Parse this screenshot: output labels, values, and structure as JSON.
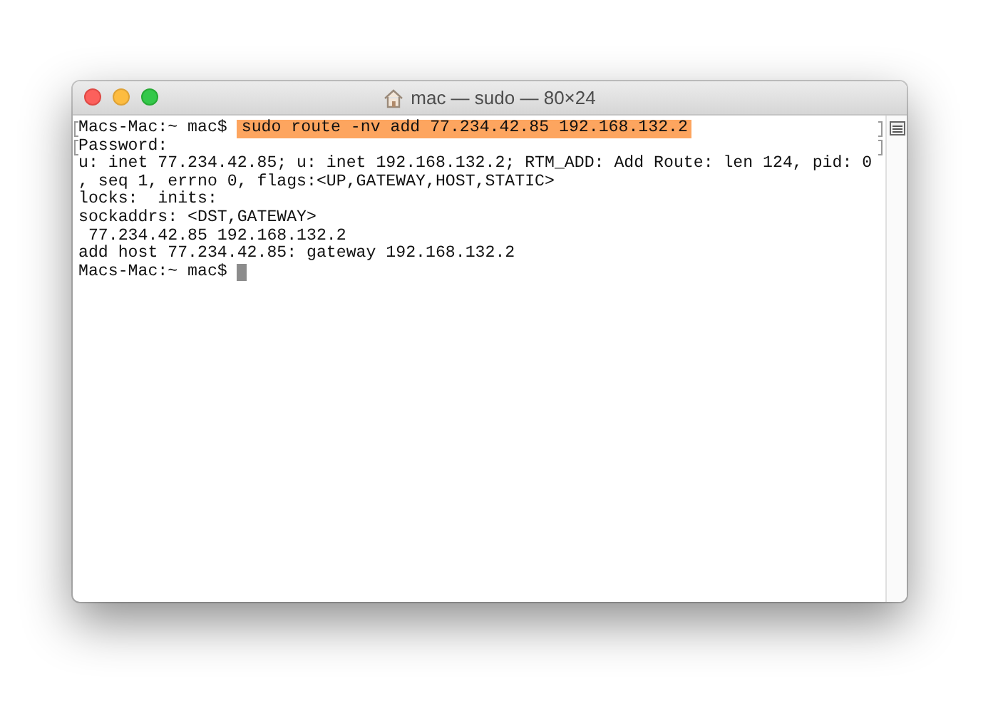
{
  "window": {
    "title": "mac — sudo — 80×24"
  },
  "lines": [
    {
      "kind": "prompt",
      "prompt": "Macs-Mac:~ mac$",
      "command": "sudo route -nv add 77.234.42.85 192.168.132.2",
      "highlighted": true,
      "marked": true,
      "cursor": false
    },
    {
      "kind": "output",
      "text": "Password:",
      "marked": true
    },
    {
      "kind": "output",
      "text": "u: inet 77.234.42.85; u: inet 192.168.132.2; RTM_ADD: Add Route: len 124, pid: 0",
      "marked": false
    },
    {
      "kind": "output",
      "text": ", seq 1, errno 0, flags:<UP,GATEWAY,HOST,STATIC>",
      "marked": false
    },
    {
      "kind": "output",
      "text": "locks:  inits:",
      "marked": false
    },
    {
      "kind": "output",
      "text": "sockaddrs: <DST,GATEWAY>",
      "marked": false
    },
    {
      "kind": "output",
      "text": " 77.234.42.85 192.168.132.2",
      "marked": false
    },
    {
      "kind": "output",
      "text": "add host 77.234.42.85: gateway 192.168.132.2",
      "marked": false
    },
    {
      "kind": "prompt",
      "prompt": "Macs-Mac:~ mac$",
      "marked": false,
      "cursor": true
    }
  ]
}
